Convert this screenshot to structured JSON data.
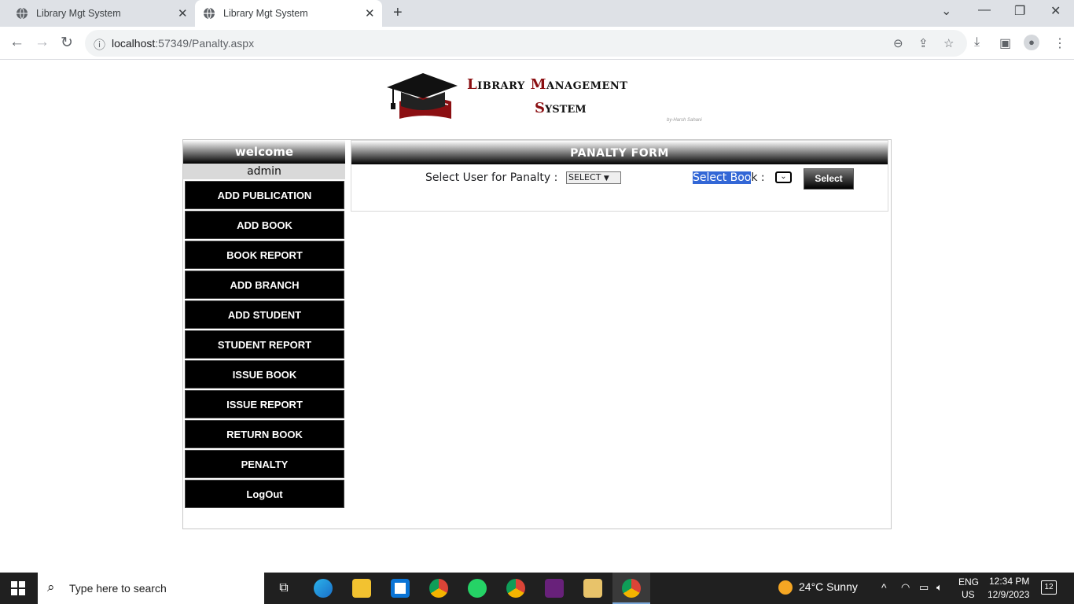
{
  "browser": {
    "tabs": [
      {
        "title": "Library Mgt System"
      },
      {
        "title": "Library Mgt System"
      }
    ],
    "url_host": "localhost",
    "url_rest": ":57349/Panalty.aspx"
  },
  "header": {
    "logo_line1_cap1": "L",
    "logo_line1_rest1": "ibrary ",
    "logo_line1_cap2": "M",
    "logo_line1_rest2": "anagement",
    "logo_line2_cap": "S",
    "logo_line2_rest": "ystem",
    "credit": "by-Harsh Sahani"
  },
  "sidebar": {
    "welcome": "welcome",
    "username": "admin",
    "items": [
      {
        "label": "ADD PUBLICATION"
      },
      {
        "label": "ADD BOOK"
      },
      {
        "label": "BOOK REPORT"
      },
      {
        "label": "ADD BRANCH"
      },
      {
        "label": "ADD STUDENT"
      },
      {
        "label": "STUDENT REPORT"
      },
      {
        "label": "ISSUE BOOK"
      },
      {
        "label": "ISSUE REPORT"
      },
      {
        "label": "RETURN BOOK"
      },
      {
        "label": "PENALTY"
      },
      {
        "label": "LogOut"
      }
    ]
  },
  "form": {
    "title": "PANALTY FORM",
    "user_label": "Select User for Panalty :",
    "user_select_value": "SELECT",
    "book_label_selected": "Select  Boo",
    "book_label_rest": "k :",
    "select_button": "Select"
  },
  "taskbar": {
    "search_placeholder": "Type here to search",
    "weather": "24°C  Sunny",
    "lang": "ENG",
    "region": "US",
    "time": "12:34 PM",
    "date": "12/9/2023",
    "notifications": "12"
  }
}
